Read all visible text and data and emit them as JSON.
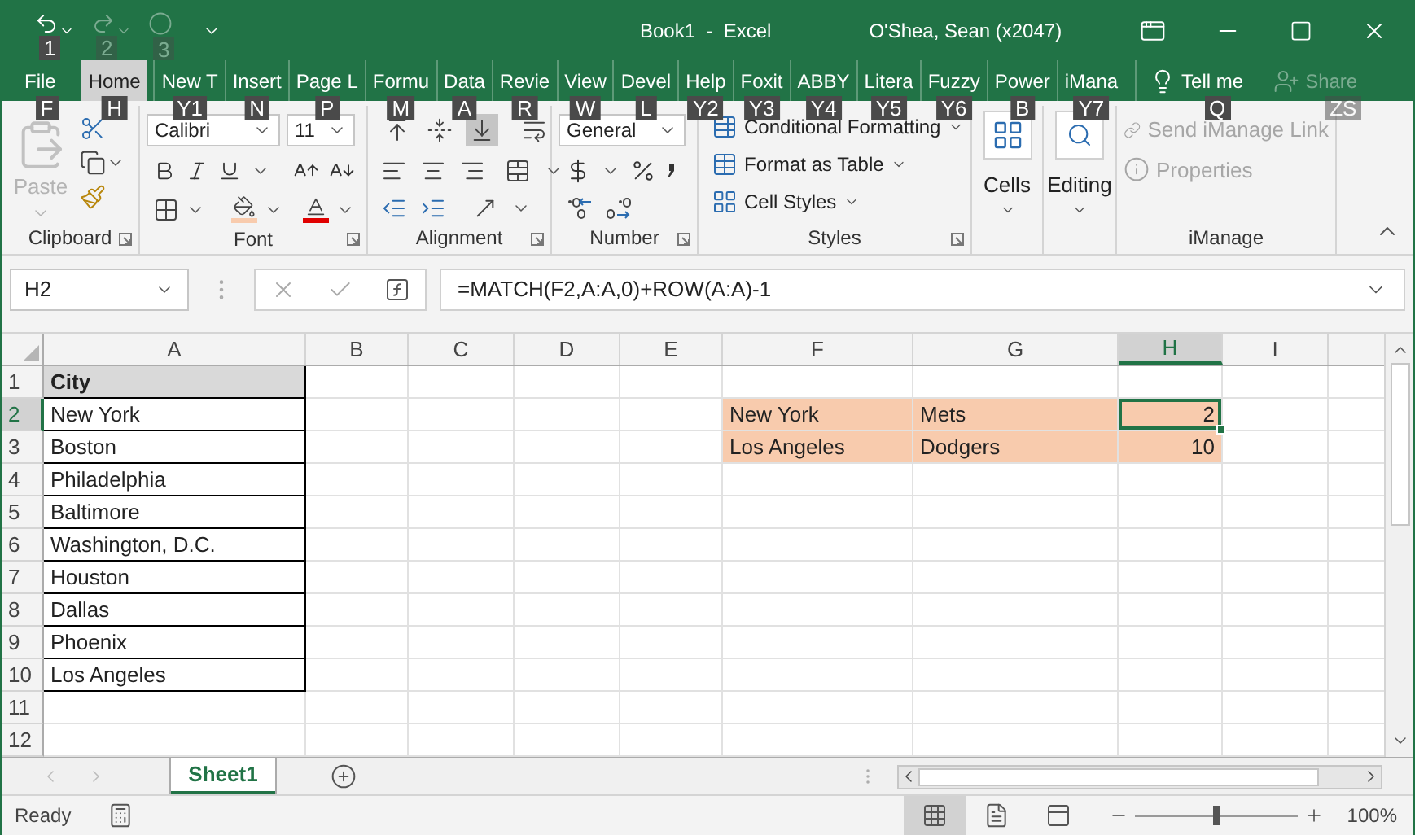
{
  "window": {
    "title": "Book1  -  Excel",
    "user": "O'Shea, Sean (x2047)"
  },
  "quick_access": [
    {
      "keytip": "1",
      "disabled": false
    },
    {
      "keytip": "2",
      "disabled": true
    },
    {
      "keytip": "3",
      "disabled": true
    }
  ],
  "tabs": [
    {
      "label": "File",
      "keytip": "F",
      "selected": false
    },
    {
      "label": "Home",
      "keytip": "H",
      "selected": true
    },
    {
      "label": "New T",
      "keytip": "Y1",
      "selected": false
    },
    {
      "label": "Insert",
      "keytip": "N",
      "selected": false
    },
    {
      "label": "Page L",
      "keytip": "P",
      "selected": false
    },
    {
      "label": "Formu",
      "keytip": "M",
      "selected": false
    },
    {
      "label": "Data",
      "keytip": "A",
      "selected": false
    },
    {
      "label": "Revie",
      "keytip": "R",
      "selected": false
    },
    {
      "label": "View",
      "keytip": "W",
      "selected": false
    },
    {
      "label": "Devel",
      "keytip": "L",
      "selected": false
    },
    {
      "label": "Help",
      "keytip": "Y2",
      "selected": false
    },
    {
      "label": "Foxit",
      "keytip": "Y3",
      "selected": false
    },
    {
      "label": "ABBY",
      "keytip": "Y4",
      "selected": false
    },
    {
      "label": "Litera",
      "keytip": "Y5",
      "selected": false
    },
    {
      "label": "Fuzzy",
      "keytip": "Y6",
      "selected": false
    },
    {
      "label": "Power",
      "keytip": "B",
      "selected": false
    },
    {
      "label": "iMana",
      "keytip": "Y7",
      "selected": false
    }
  ],
  "tell_me": {
    "label": "Tell me",
    "keytip": "Q"
  },
  "share": {
    "label": "Share",
    "keytip": "ZS",
    "disabled": true
  },
  "ribbon": {
    "clipboard": {
      "title": "Clipboard",
      "paste": {
        "label": "Paste",
        "disabled": true
      }
    },
    "font": {
      "title": "Font",
      "name": "Calibri",
      "size": "11"
    },
    "alignment": {
      "title": "Alignment",
      "vertical": [
        {
          "selected": false
        },
        {
          "selected": false
        },
        {
          "selected": true
        }
      ]
    },
    "number": {
      "title": "Number",
      "format": "General"
    },
    "styles": {
      "title": "Styles",
      "items": [
        "Conditional Formatting",
        "Format as Table",
        "Cell Styles"
      ]
    },
    "cells": {
      "label": "Cells"
    },
    "editing": {
      "label": "Editing"
    },
    "imanage": {
      "title": "iManage",
      "items": [
        {
          "label": "Send iManage Link",
          "disabled": true
        },
        {
          "label": "Properties",
          "disabled": true
        }
      ]
    }
  },
  "formula_bar": {
    "name_box": "H2",
    "formula": "=MATCH(F2,A:A,0)+ROW(A:A)-1"
  },
  "grid": {
    "columns": [
      {
        "label": "A",
        "selected": false
      },
      {
        "label": "B",
        "selected": false
      },
      {
        "label": "C",
        "selected": false
      },
      {
        "label": "D",
        "selected": false
      },
      {
        "label": "E",
        "selected": false
      },
      {
        "label": "F",
        "selected": false
      },
      {
        "label": "G",
        "selected": false
      },
      {
        "label": "H",
        "selected": true
      },
      {
        "label": "I",
        "selected": false
      }
    ],
    "rows": [
      {
        "number": "1",
        "selected": false,
        "cells": [
          {
            "text": "City",
            "kind": "text",
            "bold": true,
            "color": "#d9d9d9",
            "bordered": true,
            "selected": false
          },
          null,
          null,
          null,
          null,
          null,
          null,
          null,
          null
        ]
      },
      {
        "number": "2",
        "selected": true,
        "cells": [
          {
            "text": "New York",
            "kind": "text",
            "bold": false,
            "bordered": true,
            "selected": false
          },
          null,
          null,
          null,
          null,
          {
            "text": "New York",
            "kind": "text",
            "bold": false,
            "color": "#f8cbad",
            "bordered": false,
            "selected": false
          },
          {
            "text": "Mets",
            "kind": "text",
            "bold": false,
            "color": "#f8cbad",
            "bordered": false,
            "selected": false
          },
          {
            "text": "2",
            "kind": "number",
            "bold": false,
            "color": "#f8cbad",
            "bordered": false,
            "selected": true
          },
          null
        ]
      },
      {
        "number": "3",
        "selected": false,
        "cells": [
          {
            "text": "Boston",
            "kind": "text",
            "bold": false,
            "bordered": true,
            "selected": false
          },
          null,
          null,
          null,
          null,
          {
            "text": "Los Angeles",
            "kind": "text",
            "bold": false,
            "color": "#f8cbad",
            "bordered": false,
            "selected": false
          },
          {
            "text": "Dodgers",
            "kind": "text",
            "bold": false,
            "color": "#f8cbad",
            "bordered": false,
            "selected": false
          },
          {
            "text": "10",
            "kind": "number",
            "bold": false,
            "color": "#f8cbad",
            "bordered": false,
            "selected": false
          },
          null
        ]
      },
      {
        "number": "4",
        "selected": false,
        "cells": [
          {
            "text": "Philadelphia",
            "kind": "text",
            "bold": false,
            "bordered": true,
            "selected": false
          },
          null,
          null,
          null,
          null,
          null,
          null,
          null,
          null
        ]
      },
      {
        "number": "5",
        "selected": false,
        "cells": [
          {
            "text": "Baltimore",
            "kind": "text",
            "bold": false,
            "bordered": true,
            "selected": false
          },
          null,
          null,
          null,
          null,
          null,
          null,
          null,
          null
        ]
      },
      {
        "number": "6",
        "selected": false,
        "cells": [
          {
            "text": "Washington, D.C.",
            "kind": "text",
            "bold": false,
            "bordered": true,
            "selected": false
          },
          null,
          null,
          null,
          null,
          null,
          null,
          null,
          null
        ]
      },
      {
        "number": "7",
        "selected": false,
        "cells": [
          {
            "text": "Houston",
            "kind": "text",
            "bold": false,
            "bordered": true,
            "selected": false
          },
          null,
          null,
          null,
          null,
          null,
          null,
          null,
          null
        ]
      },
      {
        "number": "8",
        "selected": false,
        "cells": [
          {
            "text": "Dallas",
            "kind": "text",
            "bold": false,
            "bordered": true,
            "selected": false
          },
          null,
          null,
          null,
          null,
          null,
          null,
          null,
          null
        ]
      },
      {
        "number": "9",
        "selected": false,
        "cells": [
          {
            "text": "Phoenix",
            "kind": "text",
            "bold": false,
            "bordered": true,
            "selected": false
          },
          null,
          null,
          null,
          null,
          null,
          null,
          null,
          null
        ]
      },
      {
        "number": "10",
        "selected": false,
        "cells": [
          {
            "text": "Los Angeles",
            "kind": "text",
            "bold": false,
            "bordered": true,
            "selected": false
          },
          null,
          null,
          null,
          null,
          null,
          null,
          null,
          null
        ]
      },
      {
        "number": "11",
        "selected": false
      },
      {
        "number": "12",
        "selected": false
      }
    ]
  },
  "sheets": [
    {
      "label": "Sheet1",
      "selected": true
    }
  ],
  "status_bar": {
    "status": "Ready",
    "views": [
      {
        "kind": "normal",
        "selected": true
      },
      {
        "kind": "page_layout",
        "selected": false
      },
      {
        "kind": "page_break",
        "selected": false
      }
    ],
    "zoom": {
      "level": 0.5,
      "reading": "100%"
    }
  }
}
